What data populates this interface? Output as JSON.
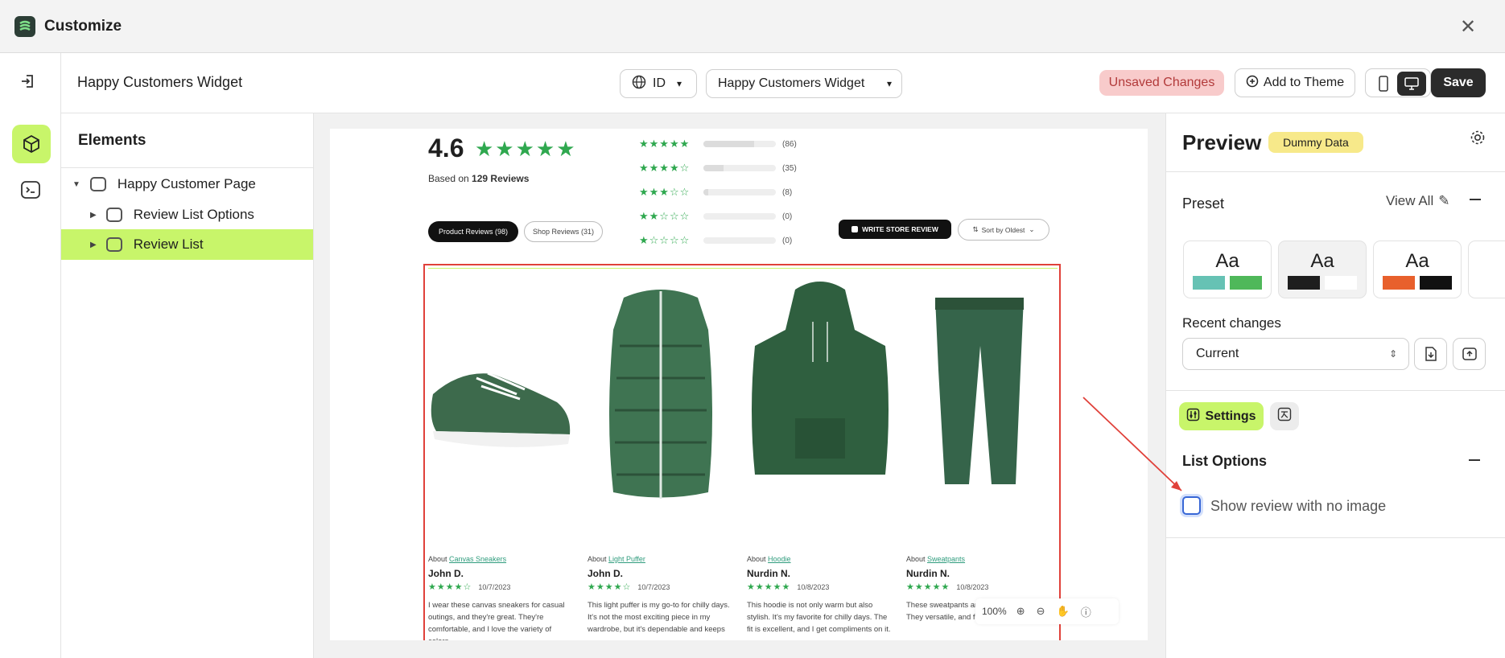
{
  "window": {
    "title": "Customize"
  },
  "topbar": {
    "page_title": "Happy Customers Widget",
    "language": "ID",
    "widget_select": "Happy Customers Widget",
    "unsaved": "Unsaved Changes",
    "add_to_theme": "Add to Theme",
    "save": "Save"
  },
  "elements": {
    "title": "Elements",
    "tree": [
      {
        "label": "Happy Customer Page"
      },
      {
        "label": "Review List Options"
      },
      {
        "label": "Review List"
      }
    ]
  },
  "preview_page": {
    "rating": "4.6",
    "based_on_prefix": "Based on ",
    "based_on_count": "129 Reviews",
    "histogram": [
      {
        "stars": 5,
        "count": "(86)",
        "fill": 0.7
      },
      {
        "stars": 4,
        "count": "(35)",
        "fill": 0.28
      },
      {
        "stars": 3,
        "count": "(8)",
        "fill": 0.07
      },
      {
        "stars": 2,
        "count": "(0)",
        "fill": 0
      },
      {
        "stars": 1,
        "count": "(0)",
        "fill": 0
      }
    ],
    "tab_product": "Product Reviews (98)",
    "tab_shop": "Shop Reviews (31)",
    "write_review": "WRITE STORE REVIEW",
    "sort": "Sort by Oldest",
    "reviews": [
      {
        "about": "About ",
        "product": "Canvas Sneakers",
        "name": "John D.",
        "stars": 4,
        "date": "10/7/2023",
        "text": "I wear these canvas sneakers for casual outings, and they're great. They're comfortable, and I love the variety of colors"
      },
      {
        "about": "About ",
        "product": "Light Puffer",
        "name": "John D.",
        "stars": 4,
        "date": "10/7/2023",
        "text": "This light puffer is my go-to for chilly days. It's not the most exciting piece in my wardrobe, but it's dependable and keeps"
      },
      {
        "about": "About ",
        "product": "Hoodie",
        "name": "Nurdin N.",
        "stars": 5,
        "date": "10/8/2023",
        "text": "This hoodie is not only warm but also stylish. It's my favorite for chilly days. The fit is excellent, and I get compliments on it."
      },
      {
        "about": "About ",
        "product": "Sweatpants",
        "name": "Nurdin N.",
        "stars": 5,
        "date": "10/8/2023",
        "text": "These sweatpants are essential for me. They versatile, and fit perfectly. I can't"
      }
    ],
    "zoom": "100%"
  },
  "panel": {
    "title": "Preview",
    "badge": "Dummy Data",
    "preset_label": "Preset",
    "view_all": "View All",
    "presets": [
      {
        "sample": "Aa",
        "colors": [
          "#66c2b4",
          "#4fb85a"
        ]
      },
      {
        "sample": "Aa",
        "colors": [
          "#1e1e1e",
          "#ffffff"
        ]
      },
      {
        "sample": "Aa",
        "colors": [
          "#e8602c",
          "#111111"
        ]
      }
    ],
    "recent_label": "Recent changes",
    "recent_value": "Current",
    "settings_tab": "Settings",
    "section": "List Options",
    "checkbox_label": "Show review with no image"
  },
  "colors": {
    "accent": "#c8f56a",
    "save_bg": "#2b2b2b",
    "unsaved_bg": "#f8cbcb",
    "unsaved_text": "#b23a3a",
    "star": "#2fa84f",
    "selection_red": "#e0413a"
  }
}
